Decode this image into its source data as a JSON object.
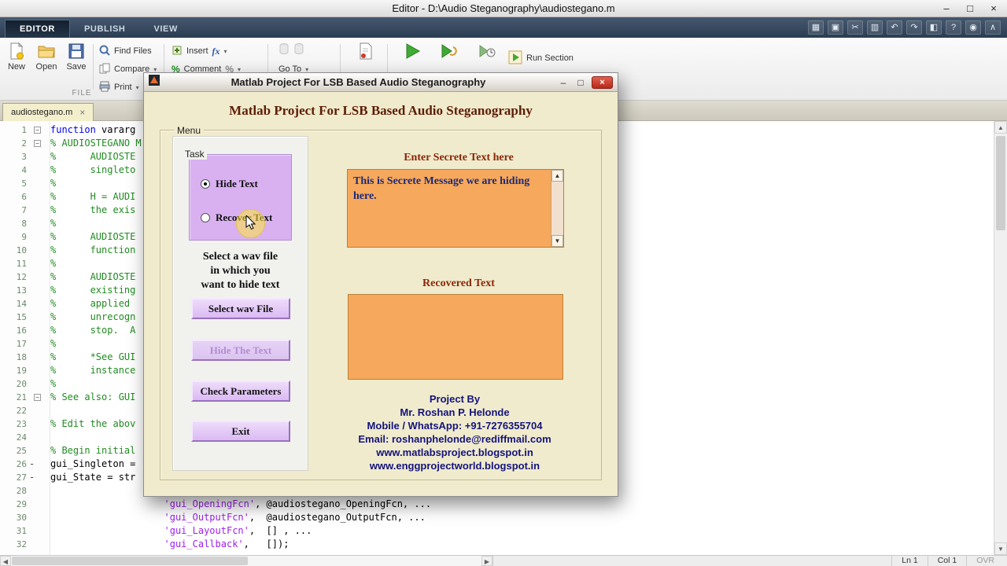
{
  "window": {
    "title": "Editor - D:\\Audio Steganography\\audiostegano.m",
    "controls": {
      "minimize": "–",
      "maximize": "□",
      "close": "×"
    }
  },
  "toolstrip": {
    "tabs": [
      {
        "label": "EDITOR",
        "active": true
      },
      {
        "label": "PUBLISH",
        "active": false
      },
      {
        "label": "VIEW",
        "active": false
      }
    ],
    "quick_icons": [
      {
        "name": "desktop-layout-icon",
        "glyph": "▦"
      },
      {
        "name": "save-quick-icon",
        "glyph": "▣"
      },
      {
        "name": "cut-icon",
        "glyph": "✂"
      },
      {
        "name": "copy-icon",
        "glyph": "▥"
      },
      {
        "name": "undo-icon",
        "glyph": "↶"
      },
      {
        "name": "redo-icon",
        "glyph": "↷"
      },
      {
        "name": "switch-window-icon",
        "glyph": "◧"
      },
      {
        "name": "help-icon",
        "glyph": "?"
      },
      {
        "name": "community-icon",
        "glyph": "◉"
      },
      {
        "name": "collapse-toolstrip-icon",
        "glyph": "∧"
      }
    ],
    "file_group_label": "FILE",
    "buttons": {
      "new": "New",
      "open": "Open",
      "save": "Save",
      "find_files": "Find Files",
      "compare": "Compare",
      "print": "Print",
      "insert": "Insert",
      "fx": "fx",
      "comment": "Comment",
      "percent": "%",
      "go_to": "Go To",
      "run_section": "Run Section"
    }
  },
  "editor": {
    "tab": {
      "name": "audiostegano.m",
      "close": "×"
    },
    "lines": [
      {
        "n": 1,
        "fold": true,
        "segs": [
          [
            "kw",
            "function"
          ],
          [
            "txt",
            " vararg"
          ]
        ]
      },
      {
        "n": 2,
        "fold": true,
        "segs": [
          [
            "com",
            "% AUDIOSTEGANO M"
          ]
        ]
      },
      {
        "n": 3,
        "segs": [
          [
            "com",
            "%      AUDIOSTE"
          ]
        ]
      },
      {
        "n": 4,
        "segs": [
          [
            "com",
            "%      singleto"
          ]
        ]
      },
      {
        "n": 5,
        "segs": [
          [
            "com",
            "%"
          ]
        ]
      },
      {
        "n": 6,
        "segs": [
          [
            "com",
            "%      H = AUDI"
          ]
        ]
      },
      {
        "n": 7,
        "segs": [
          [
            "com",
            "%      the exis"
          ]
        ]
      },
      {
        "n": 8,
        "segs": [
          [
            "com",
            "%"
          ]
        ]
      },
      {
        "n": 9,
        "segs": [
          [
            "com",
            "%      AUDIOSTE"
          ]
        ]
      },
      {
        "n": 10,
        "segs": [
          [
            "com",
            "%      function"
          ]
        ]
      },
      {
        "n": 11,
        "segs": [
          [
            "com",
            "%"
          ]
        ]
      },
      {
        "n": 12,
        "segs": [
          [
            "com",
            "%      AUDIOSTE"
          ]
        ]
      },
      {
        "n": 13,
        "segs": [
          [
            "com",
            "%      existing"
          ]
        ]
      },
      {
        "n": 14,
        "segs": [
          [
            "com",
            "%      applied "
          ]
        ]
      },
      {
        "n": 15,
        "segs": [
          [
            "com",
            "%      unrecogn"
          ]
        ]
      },
      {
        "n": 16,
        "segs": [
          [
            "com",
            "%      stop.  A"
          ]
        ]
      },
      {
        "n": 17,
        "segs": [
          [
            "com",
            "%"
          ]
        ]
      },
      {
        "n": 18,
        "segs": [
          [
            "com",
            "%      *See GUI"
          ]
        ]
      },
      {
        "n": 19,
        "segs": [
          [
            "com",
            "%      instance"
          ]
        ]
      },
      {
        "n": 20,
        "segs": [
          [
            "com",
            "%"
          ]
        ]
      },
      {
        "n": 21,
        "fold": true,
        "segs": [
          [
            "com",
            "% See also: GUI"
          ]
        ]
      },
      {
        "n": 22,
        "segs": []
      },
      {
        "n": 23,
        "segs": [
          [
            "com",
            "% Edit the abov"
          ]
        ]
      },
      {
        "n": 24,
        "segs": []
      },
      {
        "n": 25,
        "segs": [
          [
            "com",
            "% Begin initial"
          ]
        ]
      },
      {
        "n": 26,
        "dash": true,
        "segs": [
          [
            "txt",
            "gui_Singleton ="
          ]
        ]
      },
      {
        "n": 27,
        "dash": true,
        "segs": [
          [
            "txt",
            "gui_State = str"
          ]
        ]
      },
      {
        "n": 28,
        "segs": []
      },
      {
        "n": 29,
        "segs": [
          [
            "txt",
            "                    "
          ],
          [
            "str",
            "'gui_OpeningFcn'"
          ],
          [
            "txt",
            ", @audiostegano_OpeningFcn, ..."
          ]
        ]
      },
      {
        "n": 30,
        "segs": [
          [
            "txt",
            "                    "
          ],
          [
            "str",
            "'gui_OutputFcn'"
          ],
          [
            "txt",
            ",  @audiostegano_OutputFcn, ..."
          ]
        ]
      },
      {
        "n": 31,
        "segs": [
          [
            "txt",
            "                    "
          ],
          [
            "str",
            "'gui_LayoutFcn'"
          ],
          [
            "txt",
            ",  [] , ..."
          ]
        ]
      },
      {
        "n": 32,
        "segs": [
          [
            "txt",
            "                    "
          ],
          [
            "str",
            "'gui_Callback'"
          ],
          [
            "txt",
            ",   []);"
          ]
        ]
      }
    ]
  },
  "statusbar": {
    "ln": "Ln 1",
    "col": "Col 1",
    "ovr": "OVR"
  },
  "dialog": {
    "title": "Matlab Project For LSB Based Audio Steganography",
    "heading": "Matlab Project For LSB Based Audio Steganography",
    "menu_label": "Menu",
    "task_label": "Task",
    "radios": [
      {
        "label": "Hide Text",
        "selected": true
      },
      {
        "label": "Recover Text",
        "selected": false
      }
    ],
    "instruction": "Select a wav file\nin which you\nwant to hide text",
    "buttons": [
      {
        "id": "select-wav-file",
        "label": "Select wav File",
        "enabled": true
      },
      {
        "id": "hide-the-text",
        "label": "Hide The Text",
        "enabled": false
      },
      {
        "id": "check-parameters",
        "label": "Check Parameters",
        "enabled": true
      },
      {
        "id": "exit",
        "label": "Exit",
        "enabled": true
      }
    ],
    "secret_label": "Enter Secrete Text here",
    "secret_text": "This is Secrete Message we are hiding here.",
    "recovered_label": "Recovered Text",
    "project_lines": [
      "Project By",
      "Mr. Roshan P. Helonde",
      "Mobile / WhatsApp: +91-7276355704",
      "Email: roshanphelonde@rediffmail.com",
      "www.matlabsproject.blogspot.in",
      "www.enggprojectworld.blogspot.in"
    ],
    "controls": {
      "minimize": "–",
      "maximize": "□",
      "close": "×"
    }
  },
  "colors": {
    "accent_purple": "#d9b1f1",
    "accent_orange": "#f6a85c",
    "heading_maroon": "#8c2607",
    "text_navy": "#14137c"
  }
}
